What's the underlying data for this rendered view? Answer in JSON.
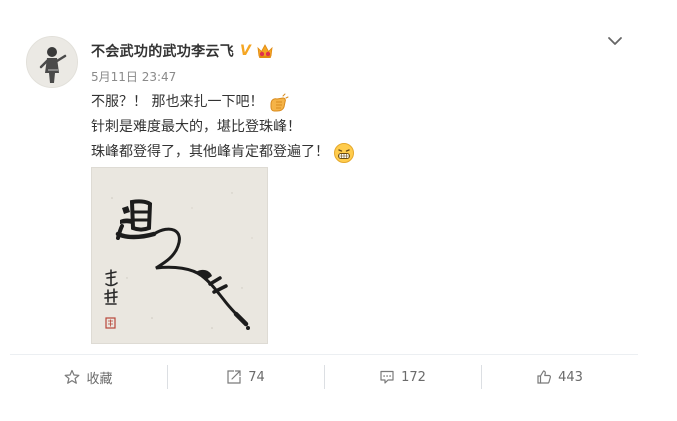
{
  "post": {
    "username": "不会武功的武功李云飞",
    "verified_badge": "V",
    "badge_icon": "crown-badge-icon",
    "timestamp": "5月11日 23:47",
    "lines": [
      {
        "text": "不服？！ 那也来扎一下吧！",
        "emoji": "fist-icon"
      },
      {
        "text": "针刺是难度最大的，堪比登珠峰！",
        "emoji": null
      },
      {
        "text": "珠峰都登得了，其他峰肯定都登遍了！",
        "emoji": "grin-icon"
      }
    ],
    "artwork_icon": "calligraphy-artwork"
  },
  "actions": {
    "favorite_label": "收藏",
    "repost_count": "74",
    "comment_count": "172",
    "like_count": "443"
  },
  "colors": {
    "text": "#333333",
    "muted": "#8a8a8a",
    "accent": "#f5a623",
    "divider": "#eceff2"
  }
}
